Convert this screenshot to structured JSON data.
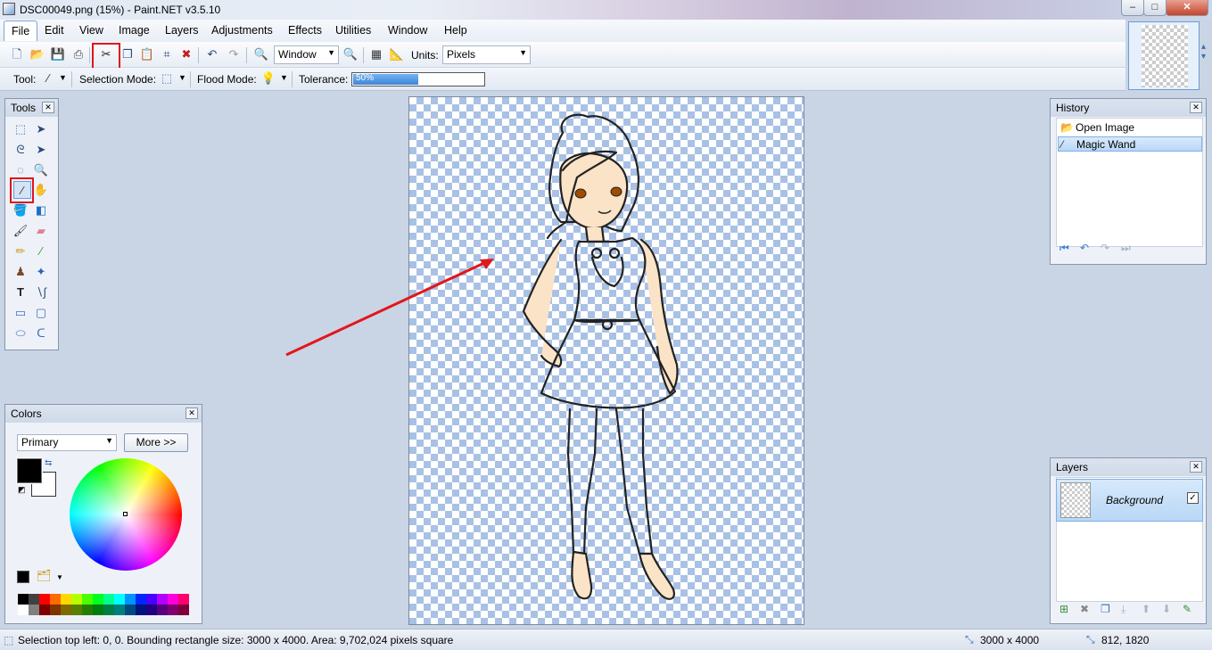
{
  "window": {
    "title": "DSC00049.png (15%) - Paint.NET v3.5.10",
    "minimize_glyph": "–",
    "maximize_glyph": "□",
    "close_glyph": "✕"
  },
  "menu": [
    "File",
    "Edit",
    "View",
    "Image",
    "Layers",
    "Adjustments",
    "Effects",
    "Utilities",
    "Window",
    "Help"
  ],
  "toolbar": {
    "zoom_combo": "Window",
    "units_label": "Units:",
    "units_value": "Pixels",
    "tool_label": "Tool:",
    "selection_mode_label": "Selection Mode:",
    "flood_mode_label": "Flood Mode:",
    "tolerance_label": "Tolerance:",
    "tolerance_value": "50%",
    "tolerance_fraction": 0.5
  },
  "panels": {
    "tools": {
      "title": "Tools"
    },
    "colors": {
      "title": "Colors",
      "mode": "Primary",
      "more_button": "More >>",
      "primary_color": "#000000",
      "secondary_color": "#ffffff"
    },
    "history": {
      "title": "History",
      "items": [
        "Open Image",
        "Magic Wand"
      ]
    },
    "layers": {
      "title": "Layers",
      "items": [
        {
          "name": "Background",
          "visible_mark": "✓"
        }
      ]
    }
  },
  "palette_colors": [
    "#000000",
    "#404040",
    "#ff0000",
    "#ff6a00",
    "#ffd800",
    "#b6ff00",
    "#4cff00",
    "#00ff21",
    "#00ff90",
    "#00ffff",
    "#0094ff",
    "#0026ff",
    "#4800ff",
    "#b200ff",
    "#ff00dc",
    "#ff006e",
    "#ffffff",
    "#808080",
    "#7f0000",
    "#7f3300",
    "#7f6a00",
    "#5b7f00",
    "#267f00",
    "#007f0e",
    "#007f46",
    "#007f7f",
    "#004a7f",
    "#00137f",
    "#21007f",
    "#57007f",
    "#7f006e",
    "#7f0037"
  ],
  "status": {
    "selection": "Selection top left: 0, 0. Bounding rectangle size: 3000 x 4000. Area: 9,702,024 pixels square",
    "image_size": "3000 x 4000",
    "cursor": "812, 1820"
  }
}
